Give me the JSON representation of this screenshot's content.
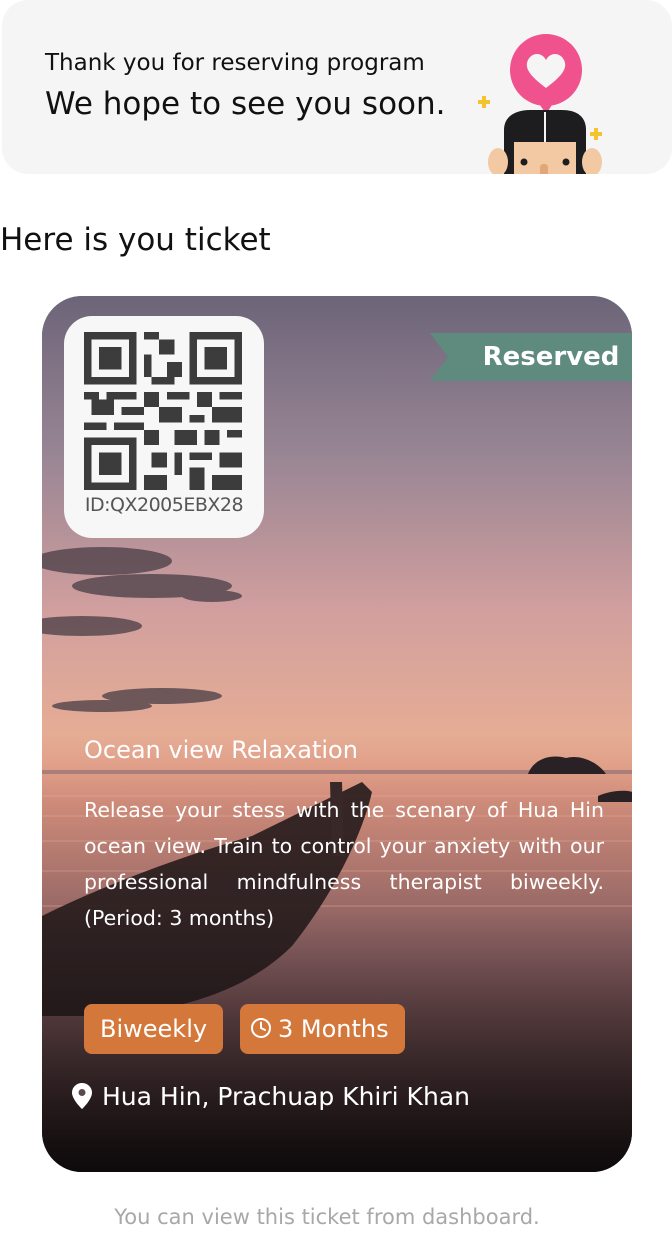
{
  "banner": {
    "line1": "Thank you for reserving program",
    "line2": "We hope to see you soon."
  },
  "section": {
    "title": "Here is you ticket"
  },
  "ticket": {
    "id": "ID:QX2005EBX28",
    "status": "Reserved",
    "title": "Ocean view Relaxation",
    "description": "Release your stess with the scenary of Hua Hin ocean view. Train to control your anxiety with our professional mindfulness therapist biweekly. (Period: 3 months)",
    "tags": {
      "frequency": "Biweekly",
      "duration": "3 Months"
    },
    "location": "Hua Hin, Prachuap Khiri Khan"
  },
  "footer": {
    "note": "You can view this ticket from dashboard."
  },
  "colors": {
    "badge": "#5e8b7e",
    "tag": "#d4773a",
    "heart": "#f0528d",
    "sparkle": "#f4c430"
  }
}
